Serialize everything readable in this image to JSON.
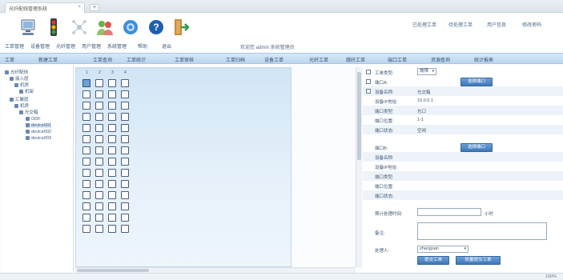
{
  "browser": {
    "tab_title": "光纤配线管理系统",
    "tab_close": "×",
    "new_tab": "+"
  },
  "toolbar": {
    "items": [
      {
        "label": "工单管理",
        "icon": "computer-icon"
      },
      {
        "label": "设备管理",
        "icon": "traffic-light-icon"
      },
      {
        "label": "光纤管理",
        "icon": "network-icon"
      },
      {
        "label": "用户管理",
        "icon": "users-icon"
      },
      {
        "label": "系统管理",
        "icon": "settings-icon"
      },
      {
        "label": "帮助",
        "icon": "help-icon"
      },
      {
        "label": "退出",
        "icon": "exit-icon"
      }
    ],
    "names": [
      "工单管理",
      "设备管理",
      "光纤管理",
      "用户管理",
      "系统管理",
      "帮助",
      "退出"
    ],
    "welcome": "欢迎您 admin 系统管理员",
    "top_links": [
      "已处理工单",
      "待处理工单",
      "用户信息",
      "修改密码"
    ]
  },
  "menu": {
    "items": [
      "工单",
      "新建工单",
      "工单查询",
      "工单统计",
      "工单审核",
      "工单归档",
      "设备工单",
      "光纤工单",
      "跳纤工单",
      "端口工单",
      "资源查询",
      "统计报表"
    ]
  },
  "tree": {
    "nodes": [
      {
        "label": "光纤配线",
        "level": 0
      },
      {
        "label": "接入层",
        "level": 1
      },
      {
        "label": "机房",
        "level": 2
      },
      {
        "label": "机架",
        "level": 3
      },
      {
        "label": "汇聚层",
        "level": 1
      },
      {
        "label": "机房",
        "level": 2
      },
      {
        "label": "光交箱",
        "level": 3
      },
      {
        "label": "ODF",
        "level": 4
      },
      {
        "label": "device001",
        "level": 4
      },
      {
        "label": "device002",
        "level": 4
      },
      {
        "label": "device003",
        "level": 4
      }
    ]
  },
  "grid": {
    "headers": [
      "1",
      "2",
      "3",
      "4"
    ],
    "rows": 14,
    "cols": 4,
    "selected_port": "1-1"
  },
  "form": {
    "work_type_label": "工单类型:",
    "work_type_value": "故障",
    "port_a_label": "端口A:",
    "select_a_button": "选择端口",
    "fields_a": [
      {
        "label": "设备名称:",
        "value": "光交箱"
      },
      {
        "label": "设备IP地址:",
        "value": "10.0.0.1"
      },
      {
        "label": "端口类型:",
        "value": "光口"
      },
      {
        "label": "端口位置:",
        "value": "1-1"
      },
      {
        "label": "端口状态:",
        "value": "空闲"
      }
    ],
    "port_b_label": "端口B:",
    "select_b_button": "选择端口",
    "fields_b": [
      {
        "label": "设备名称:",
        "value": ""
      },
      {
        "label": "设备IP地址:",
        "value": ""
      },
      {
        "label": "端口类型:",
        "value": ""
      },
      {
        "label": "端口位置:",
        "value": ""
      },
      {
        "label": "端口状态:",
        "value": ""
      }
    ],
    "duration_label": "预计处理时间:",
    "duration_value": "",
    "duration_unit": "小时",
    "remark_label": "备注:",
    "remark_value": "",
    "handler_label": "处理人:",
    "handler_value": "zhangsan",
    "submit_button": "提交工单",
    "batch_button": "批量提交工单"
  },
  "status": {
    "right_text": "100%"
  }
}
